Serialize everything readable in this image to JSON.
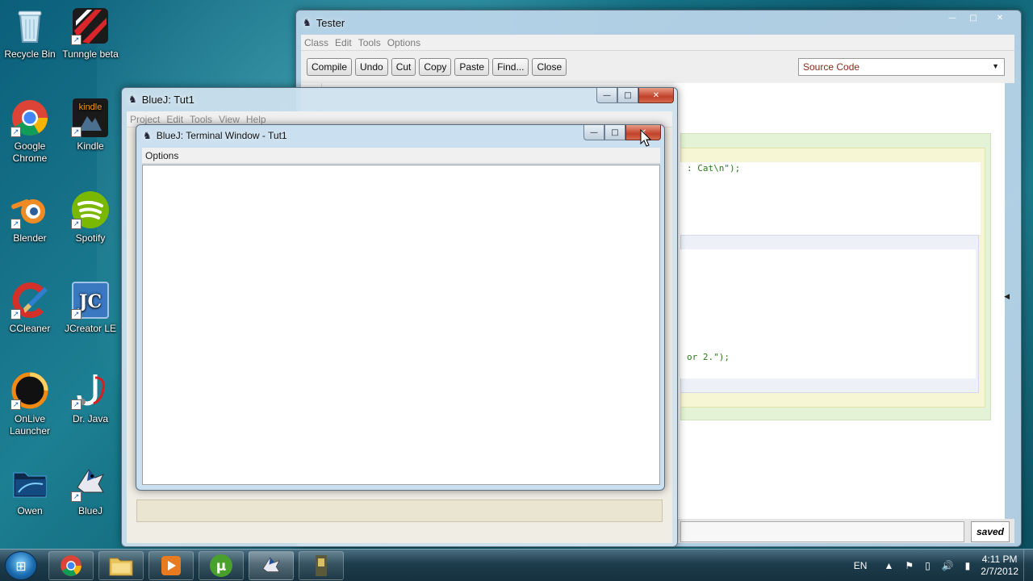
{
  "desktop": {
    "icons": [
      {
        "label": "Recycle Bin",
        "icon": "recycle-bin-icon",
        "glyph": "🗑"
      },
      {
        "label": "Tunngle beta",
        "icon": "tunngle-icon",
        "glyph": "▰"
      },
      {
        "label": "Google Chrome",
        "icon": "chrome-icon",
        "glyph": "◉"
      },
      {
        "label": "Kindle",
        "icon": "kindle-icon",
        "glyph": "kindle"
      },
      {
        "label": "Blender",
        "icon": "blender-icon",
        "glyph": "◐"
      },
      {
        "label": "Spotify",
        "icon": "spotify-icon",
        "glyph": "≋"
      },
      {
        "label": "CCleaner",
        "icon": "ccleaner-icon",
        "glyph": "C"
      },
      {
        "label": "JCreator LE",
        "icon": "jcreator-icon",
        "glyph": "JC"
      },
      {
        "label": "OnLive Launcher",
        "icon": "onlive-icon",
        "glyph": "◔"
      },
      {
        "label": "Dr. Java",
        "icon": "drjava-icon",
        "glyph": "J"
      },
      {
        "label": "Owen",
        "icon": "user-folder-icon",
        "glyph": "▂"
      },
      {
        "label": "BlueJ",
        "icon": "bluej-icon",
        "glyph": "♞"
      }
    ],
    "shortcut_arrow": "↗"
  },
  "tester_window": {
    "title": "Tester",
    "menu": [
      "Class",
      "Edit",
      "Tools",
      "Options"
    ],
    "toolbar": [
      "Compile",
      "Undo",
      "Cut",
      "Copy",
      "Paste",
      "Find...",
      "Close"
    ],
    "view_select": "Source Code",
    "code_line_1": ": Cat\\n\");",
    "code_line_2": "or 2.\");",
    "status": "saved",
    "collapse_arrow": "◀"
  },
  "bluej_window": {
    "title": "BlueJ:  Tut1",
    "menu": [
      "Project",
      "Edit",
      "Tools",
      "View",
      "Help"
    ]
  },
  "terminal_window": {
    "title": "BlueJ: Terminal Window - Tut1",
    "menu": [
      "Options"
    ]
  },
  "window_controls": {
    "minimize": "—",
    "maximize": "□",
    "close": "✕"
  },
  "taskbar": {
    "start": "⊞",
    "apps": [
      {
        "name": "chrome",
        "glyph": "◉"
      },
      {
        "name": "explorer",
        "glyph": "▤"
      },
      {
        "name": "media-player",
        "glyph": "▶"
      },
      {
        "name": "utorrent",
        "glyph": "µ"
      },
      {
        "name": "bluej",
        "glyph": "♞"
      },
      {
        "name": "java-app",
        "glyph": "▮"
      }
    ],
    "language": "EN",
    "time": "4:11 PM",
    "date": "2/7/2012"
  },
  "colors": {
    "close_red": "#c2412a",
    "editor_green": "#e4f2d5",
    "editor_yellow": "#f7f6d4",
    "code_green": "#2a7a1a"
  }
}
